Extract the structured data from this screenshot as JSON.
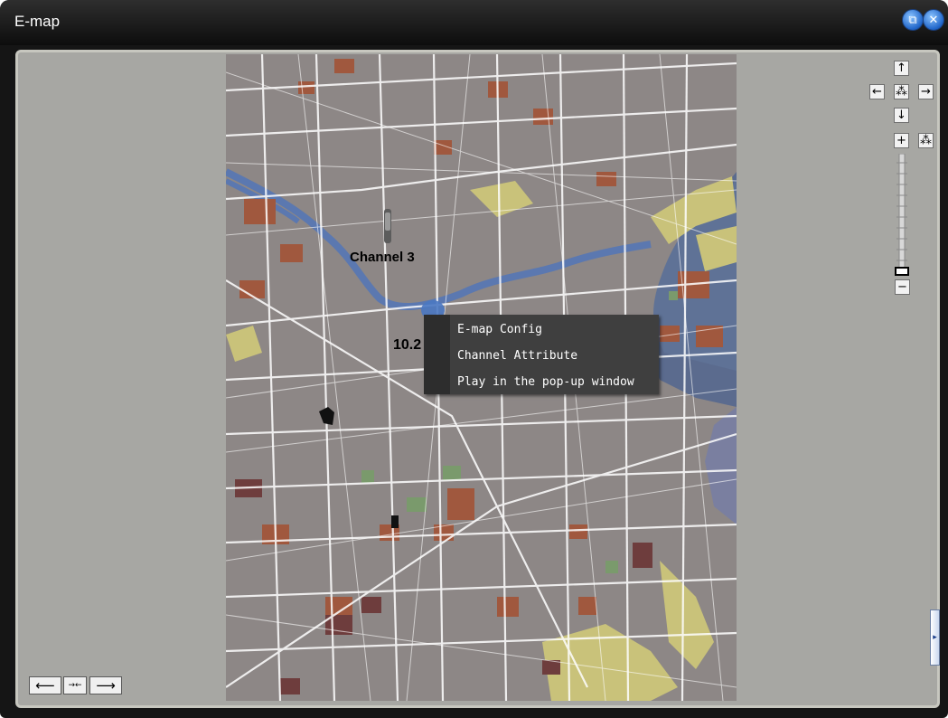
{
  "window": {
    "title": "E-map",
    "restore_icon": "restore-icon",
    "close_icon": "close-icon"
  },
  "map": {
    "overlay_channel_label": "Channel 3",
    "overlay_partial_label": "10.2"
  },
  "context_menu": {
    "items": [
      {
        "label": "E-map Config"
      },
      {
        "label": "Channel Attribute"
      },
      {
        "label": "Play in the pop-up window"
      }
    ]
  },
  "nav_controls": {
    "up_glyph": "↑",
    "left_glyph": "←",
    "center_glyph": "⁂",
    "right_glyph": "→",
    "down_glyph": "↓",
    "zoom_in_glyph": "+",
    "reset_glyph": "⁂",
    "zoom_out_glyph": "−"
  },
  "bottom_bar": {
    "prev_glyph": "⟵",
    "fit_glyph": "→←",
    "next_glyph": "⟶"
  },
  "side_handle": {
    "glyph": "▸"
  },
  "colors": {
    "title_bar": "#1a1a1a",
    "panel_bg": "#a7a7a3",
    "menu_bg": "#3f3f3f",
    "map_base": "#8d8786"
  }
}
